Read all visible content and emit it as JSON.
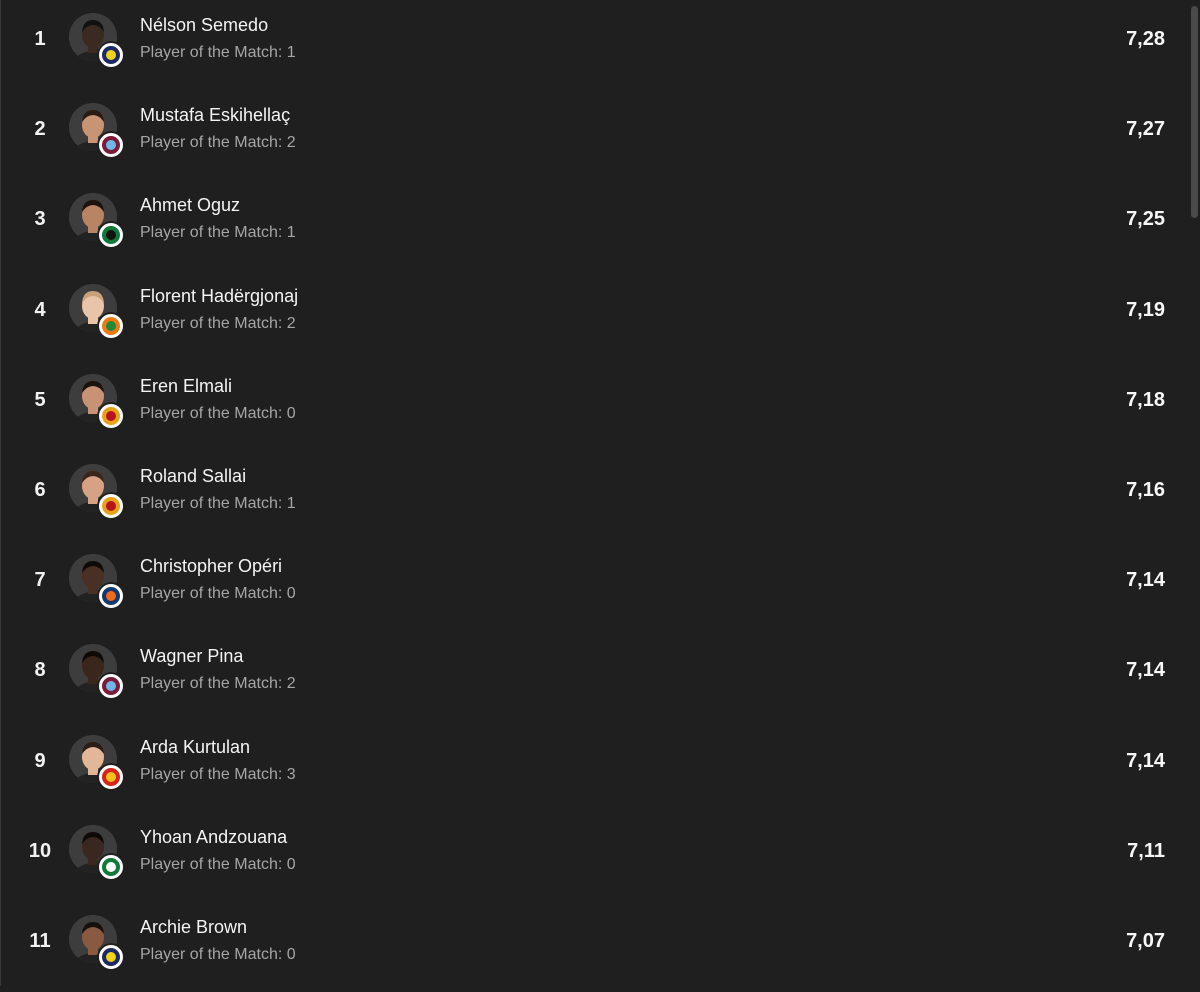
{
  "players": [
    {
      "rank": "1",
      "name": "Nélson Semedo",
      "potm": "Player of the Match: 1",
      "rating": "7,28",
      "skin": "#3a2a22",
      "hair": "#111111",
      "club": "fenerbahce-crest-icon",
      "club_colors": [
        "#1b2a64",
        "#f3d21a"
      ]
    },
    {
      "rank": "2",
      "name": "Mustafa Eskihellaç",
      "potm": "Player of the Match: 2",
      "rating": "7,27",
      "skin": "#c99473",
      "hair": "#2a1b12",
      "club": "trabzonspor-crest-icon",
      "club_colors": [
        "#7b1b3a",
        "#6fb7e6"
      ]
    },
    {
      "rank": "3",
      "name": "Ahmet Oguz",
      "potm": "Player of the Match: 1",
      "rating": "7,25",
      "skin": "#b88464",
      "hair": "#1c130e",
      "club": "kocaelispor-crest-icon",
      "club_colors": [
        "#0d7a3c",
        "#111111"
      ]
    },
    {
      "rank": "4",
      "name": "Florent Hadërgjonaj",
      "potm": "Player of the Match: 2",
      "rating": "7,19",
      "skin": "#e8c4a8",
      "hair": "#c9a27a",
      "club": "alanyaspor-crest-icon",
      "club_colors": [
        "#f07a12",
        "#1e8a3a"
      ]
    },
    {
      "rank": "5",
      "name": "Eren Elmali",
      "potm": "Player of the Match: 0",
      "rating": "7,18",
      "skin": "#c89274",
      "hair": "#1a120d",
      "club": "galatasaray-crest-icon",
      "club_colors": [
        "#e8a11b",
        "#b8121c"
      ]
    },
    {
      "rank": "6",
      "name": "Roland Sallai",
      "potm": "Player of the Match: 1",
      "rating": "7,16",
      "skin": "#d6a283",
      "hair": "#3a2618",
      "club": "galatasaray-crest-icon",
      "club_colors": [
        "#e8a11b",
        "#b8121c"
      ]
    },
    {
      "rank": "7",
      "name": "Christopher Opéri",
      "potm": "Player of the Match: 0",
      "rating": "7,14",
      "skin": "#4a3024",
      "hair": "#0e0a08",
      "club": "basaksehir-crest-icon",
      "club_colors": [
        "#13386b",
        "#f06b1a"
      ]
    },
    {
      "rank": "8",
      "name": "Wagner Pina",
      "potm": "Player of the Match: 2",
      "rating": "7,14",
      "skin": "#3b261c",
      "hair": "#0e0a08",
      "club": "trabzonspor-crest-icon",
      "club_colors": [
        "#7b1b3a",
        "#6fb7e6"
      ]
    },
    {
      "rank": "9",
      "name": "Arda Kurtulan",
      "potm": "Player of the Match: 3",
      "rating": "7,14",
      "skin": "#e2b798",
      "hair": "#2c1e14",
      "club": "goztepe-crest-icon",
      "club_colors": [
        "#d8231a",
        "#f2c21b"
      ]
    },
    {
      "rank": "10",
      "name": "Yhoan Andzouana",
      "potm": "Player of the Match: 0",
      "rating": "7,11",
      "skin": "#3a2720",
      "hair": "#0e0a08",
      "club": "konyaspor-crest-icon",
      "club_colors": [
        "#0e7a3a",
        "#ffffff"
      ]
    },
    {
      "rank": "11",
      "name": "Archie Brown",
      "potm": "Player of the Match: 0",
      "rating": "7,07",
      "skin": "#8a5a40",
      "hair": "#15100c",
      "club": "fenerbahce-crest-icon",
      "club_colors": [
        "#1b2a64",
        "#f3d21a"
      ]
    }
  ]
}
